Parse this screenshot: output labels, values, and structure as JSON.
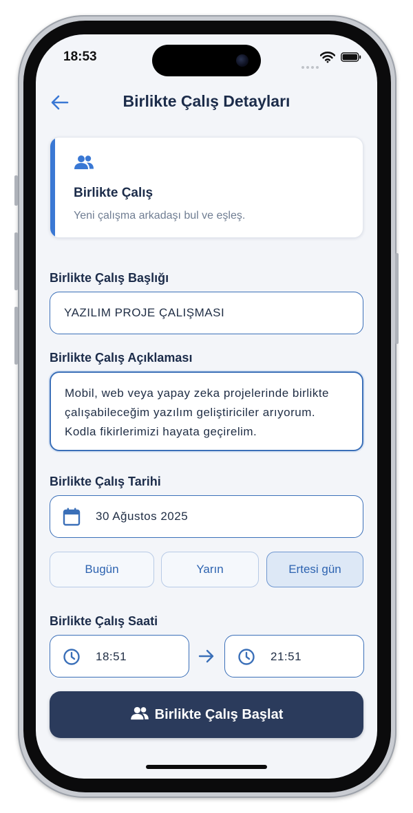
{
  "status_bar": {
    "time": "18:53"
  },
  "header": {
    "title": "Birlikte Çalış Detayları"
  },
  "info_card": {
    "title": "Birlikte Çalış",
    "subtitle": "Yeni çalışma arkadaşı bul ve eşleş."
  },
  "form": {
    "title_label": "Birlikte Çalış Başlığı",
    "title_value": "YAZILIM PROJE ÇALIŞMASI",
    "description_label": "Birlikte Çalış Açıklaması",
    "description_value": "Mobil, web veya yapay zeka projelerinde birlikte çalışabileceğim yazılım geliştiriciler arıyorum. Kodla fikirlerimizi hayata geçirelim.",
    "date_label": "Birlikte Çalış Tarihi",
    "date_value": "30 Ağustos 2025",
    "quick_dates": [
      {
        "label": "Bugün",
        "selected": false
      },
      {
        "label": "Yarın",
        "selected": false
      },
      {
        "label": "Ertesi gün",
        "selected": true
      }
    ],
    "time_label": "Birlikte Çalış Saati",
    "start_time": "18:51",
    "end_time": "21:51"
  },
  "actions": {
    "submit_label": "Birlikte Çalış Başlat"
  },
  "colors": {
    "accent": "#3a78d4",
    "primary_button": "#2b3b5c",
    "background": "#f3f5f9",
    "text_dark": "#1c2c4a"
  },
  "icons": {
    "back": "arrow-left-icon",
    "card": "people-icon",
    "date": "calendar-icon",
    "time": "clock-icon",
    "range": "arrow-right-icon",
    "submit": "people-icon"
  }
}
